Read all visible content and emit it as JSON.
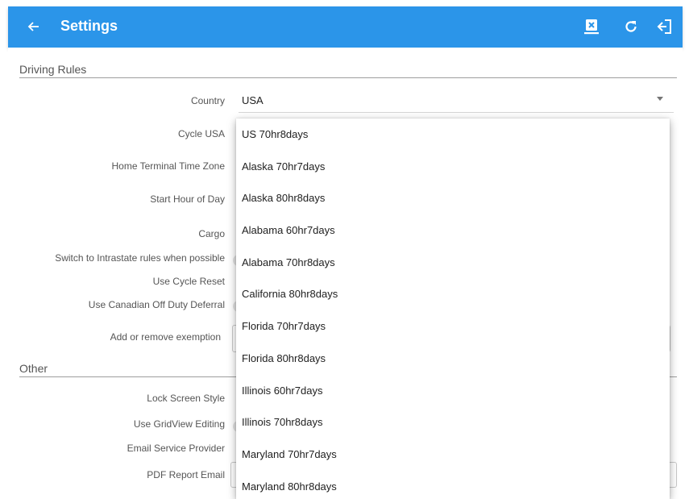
{
  "appbar": {
    "title": "Settings",
    "icons": [
      "back-arrow-icon",
      "close-box-icon",
      "refresh-icon",
      "logout-icon"
    ],
    "color": "#2b95e9"
  },
  "driving_rules": {
    "header": "Driving Rules",
    "country_label": "Country",
    "country_value": "USA",
    "cycle_label": "Cycle USA",
    "home_tz_label": "Home Terminal Time Zone",
    "start_hour_label": "Start Hour of Day",
    "cargo_label": "Cargo",
    "intrastate_label": "Switch to Intrastate rules when possible",
    "cycle_reset_label": "Use Cycle Reset",
    "canadian_deferral_label": "Use Canadian Off Duty Deferral",
    "exemption_label": "Add or remove exemption"
  },
  "other": {
    "header": "Other",
    "lock_screen_label": "Lock Screen Style",
    "gridview_label": "Use GridView Editing",
    "email_provider_label": "Email Service Provider",
    "pdf_email_label": "PDF Report Email"
  },
  "cycle_dropdown": {
    "options": [
      "US 70hr8days",
      "Alaska 70hr7days",
      "Alaska 80hr8days",
      "Alabama 60hr7days",
      "Alabama 70hr8days",
      "California 80hr8days",
      "Florida 70hr7days",
      "Florida 80hr8days",
      "Illinois 60hr7days",
      "Illinois 70hr8days",
      "Maryland 70hr7days",
      "Maryland 80hr8days"
    ]
  }
}
